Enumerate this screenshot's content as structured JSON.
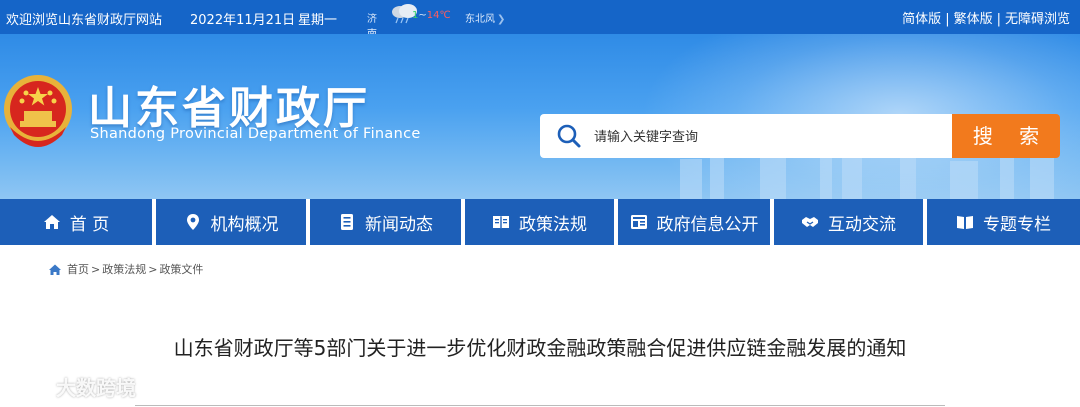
{
  "topbar": {
    "welcome": "欢迎浏览山东省财政厅网站",
    "date": "2022年11月21日",
    "weekday": "星期一",
    "weather": {
      "city": "济南",
      "temp_low": "1",
      "temp_sep": "~",
      "temp_high": "14℃",
      "wind": "东北风"
    },
    "links": [
      "简体版",
      "繁体版",
      "无障碍浏览"
    ],
    "separator": "|"
  },
  "header": {
    "title": "山东省财政厅",
    "subtitle": "Shandong Provincial Department of Finance"
  },
  "search": {
    "placeholder": "请输入关键字查询",
    "button_label": "搜 索"
  },
  "nav": [
    {
      "label": "首 页",
      "icon": "home-icon"
    },
    {
      "label": "机构概况",
      "icon": "location-pin-icon"
    },
    {
      "label": "新闻动态",
      "icon": "news-icon"
    },
    {
      "label": "政策法规",
      "icon": "book-icon"
    },
    {
      "label": "政府信息公开",
      "icon": "info-panel-icon"
    },
    {
      "label": "互动交流",
      "icon": "handshake-icon"
    },
    {
      "label": "专题专栏",
      "icon": "open-book-icon"
    }
  ],
  "breadcrumb": {
    "items": [
      "首页",
      "政策法规",
      "政策文件"
    ],
    "arrow": ">"
  },
  "article": {
    "title": "山东省财政厅等5部门关于进一步优化财政金融政策融合促进供应链金融发展的通知"
  },
  "watermark": {
    "text": "大数跨境"
  },
  "colors": {
    "topbar": "#1565c8",
    "nav": "#1d5fb8",
    "search_button": "#f27a1d"
  }
}
